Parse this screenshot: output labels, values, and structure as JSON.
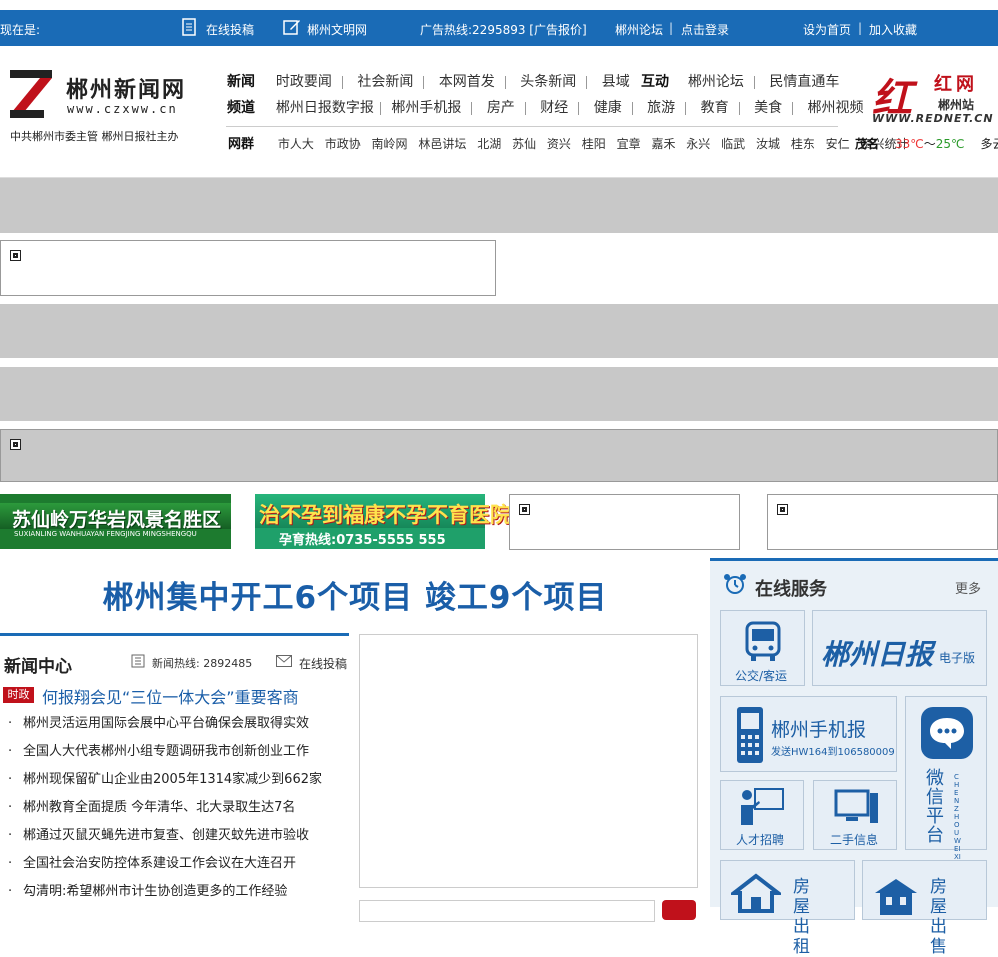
{
  "topbar": {
    "location_label": "现在是:",
    "submit_label": "在线投稿",
    "civil_label": "郴州文明网",
    "ad_hotline": "广告热线:2295893 [广告报价]",
    "forum": "郴州论坛",
    "login": "点击登录",
    "set_home": "设为首页",
    "add_fav": "加入收藏",
    "sep": "|"
  },
  "logo": {
    "title": "郴州新闻网",
    "url": "www.czxww.cn",
    "subtitle": "中共郴州市委主管 郴州日报社主办"
  },
  "nav": {
    "news_label": "新闻",
    "news_items": [
      "时政要闻",
      "社会新闻",
      "本网首发",
      "头条新闻",
      "县域"
    ],
    "interact_label": "互动",
    "interact_items": [
      "郴州论坛",
      "民情直通车"
    ],
    "channel_label": "频道",
    "channel_items": [
      "郴州日报数字报",
      "郴州手机报",
      "房产",
      "财经",
      "健康",
      "旅游",
      "教育",
      "美食",
      "郴州视频"
    ],
    "net_label": "网群",
    "net_items": [
      "市人大",
      "市政协",
      "南岭网",
      "林邑讲坛",
      "北湖",
      "苏仙",
      "资兴",
      "桂阳",
      "宜章",
      "嘉禾",
      "永兴",
      "临武",
      "汝城",
      "桂东",
      "安仁",
      "资兴统计"
    ]
  },
  "redlogo": {
    "name": "红网",
    "station": "郴州站",
    "url": "WWW.REDNET.CN"
  },
  "weather": {
    "town": "茂名",
    "high": "33℃",
    "tilde": "～",
    "low": "25℃",
    "desc": "多云"
  },
  "ads": {
    "ad1_line1": "苏仙岭万华岩风景名胜区",
    "ad1_line2": "SUXIANLING WANHUAYAN FENGJING MINGSHENGQU",
    "ad2_line1": "治不孕到福康不孕不育医院",
    "ad2_line2": "孕育热线:0735-5555 555"
  },
  "headline": "郴州集中开工6个项目 竣工9个项目",
  "news_center": {
    "title": "新闻中心",
    "hotline": "新闻热线: 2892485",
    "submit": "在线投稿",
    "tag": "时政",
    "lead": "何报翔会见“三位一体大会”重要客商",
    "items": [
      "郴州灵活运用国际会展中心平台确保会展取得实效",
      "全国人大代表郴州小组专题调研我市创新创业工作",
      "郴州现保留矿山企业由2005年1314家减少到662家",
      "郴州教育全面提质 今年清华、北大录取生达7名",
      "郴通过灭鼠灭蝇先进市复查、创建灭蚊先进市验收",
      "全国社会治安防控体系建设工作会议在大连召开",
      "勾清明:希望郴州市计生协创造更多的工作经验"
    ]
  },
  "services": {
    "title": "在线服务",
    "more": "更多",
    "bus": "公交/客运",
    "daily_logo": "郴州日报",
    "daily_label": "电子版",
    "mobile_title": "郴州手机报",
    "mobile_sub": "发送HW164到106580009",
    "wechat_cn": "微信平台",
    "wechat_py": "CHENZHOUWEIXIN",
    "jobs": "人才招聘",
    "secondhand": "二手信息",
    "rent": "房屋出租",
    "sale": "房屋出售"
  },
  "colors": {
    "brand_blue": "#1a6bb6",
    "brand_red": "#c0111b",
    "ad_grey": "#c8c8c8"
  }
}
